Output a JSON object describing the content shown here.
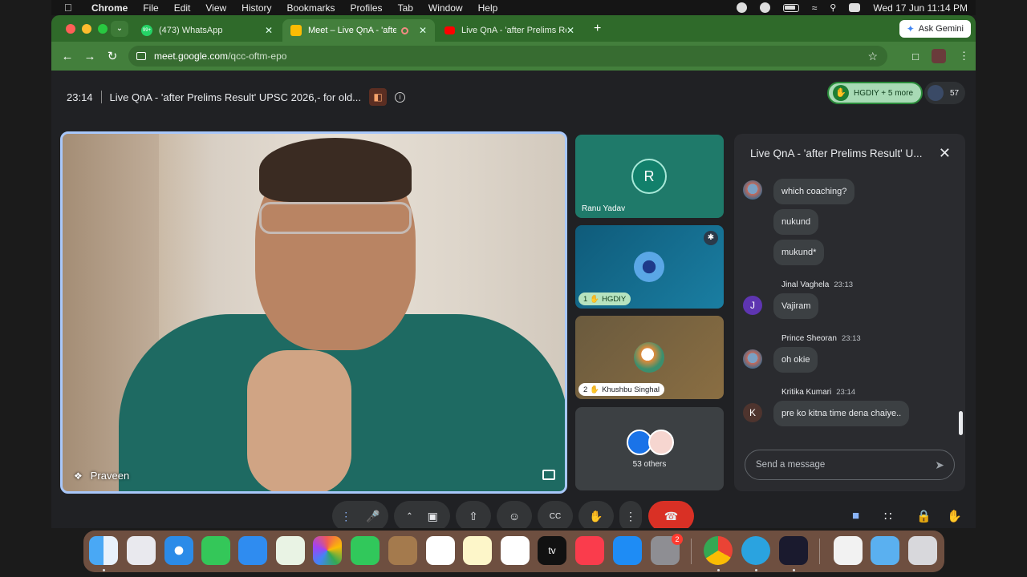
{
  "menubar": {
    "app": "Chrome",
    "items": [
      "File",
      "Edit",
      "View",
      "History",
      "Bookmarks",
      "Profiles",
      "Tab",
      "Window",
      "Help"
    ],
    "datetime": "Wed 17 Jun  11:14 PM"
  },
  "tabs": [
    {
      "label": "(473) WhatsApp",
      "badge": "99+"
    },
    {
      "label": "Meet – Live QnA - 'after P"
    },
    {
      "label": "Live QnA - 'after Prelims Resu"
    }
  ],
  "ask_gemini": "Ask Gemini",
  "omnibox": {
    "domain": "meet.google.com",
    "path": "/qcc-oftm-epo"
  },
  "meeting": {
    "time": "23:14",
    "title": "Live QnA - 'after Prelims Result' UPSC 2026,- for old...",
    "raised_hands": "HGDIY + 5 more",
    "participant_count": "57"
  },
  "main_video": {
    "name": "Praveen"
  },
  "tiles": [
    {
      "initial": "R",
      "name": "Ranu Yadav"
    },
    {
      "hand_order": "1",
      "name": "HGDIY"
    },
    {
      "hand_order": "2",
      "name": "Khushbu Singhal"
    },
    {
      "name": "53 others"
    }
  ],
  "chat": {
    "title": "Live QnA - 'after Prelims Result' U...",
    "messages": [
      {
        "text": "which coaching?"
      },
      {
        "text": "nukund"
      },
      {
        "text": "mukund*"
      },
      {
        "sender": "Jinal Vaghela",
        "time": "23:13",
        "initial": "J",
        "text": "Vajiram"
      },
      {
        "sender": "Prince Sheoran",
        "time": "23:13",
        "text": "oh okie"
      },
      {
        "sender": "Kritika Kumari",
        "time": "23:14",
        "initial": "K",
        "text": "pre ko kitna time dena chaiye.."
      }
    ],
    "input_placeholder": "Send a message"
  },
  "dock": {
    "settings_badge": "2",
    "tv_label": "tv"
  },
  "colors": {
    "tab_green": "#2f6a2a",
    "toolbar_green": "#437f3c",
    "end_call_red": "#d93025",
    "chat_accent": "#8ab4f8"
  }
}
